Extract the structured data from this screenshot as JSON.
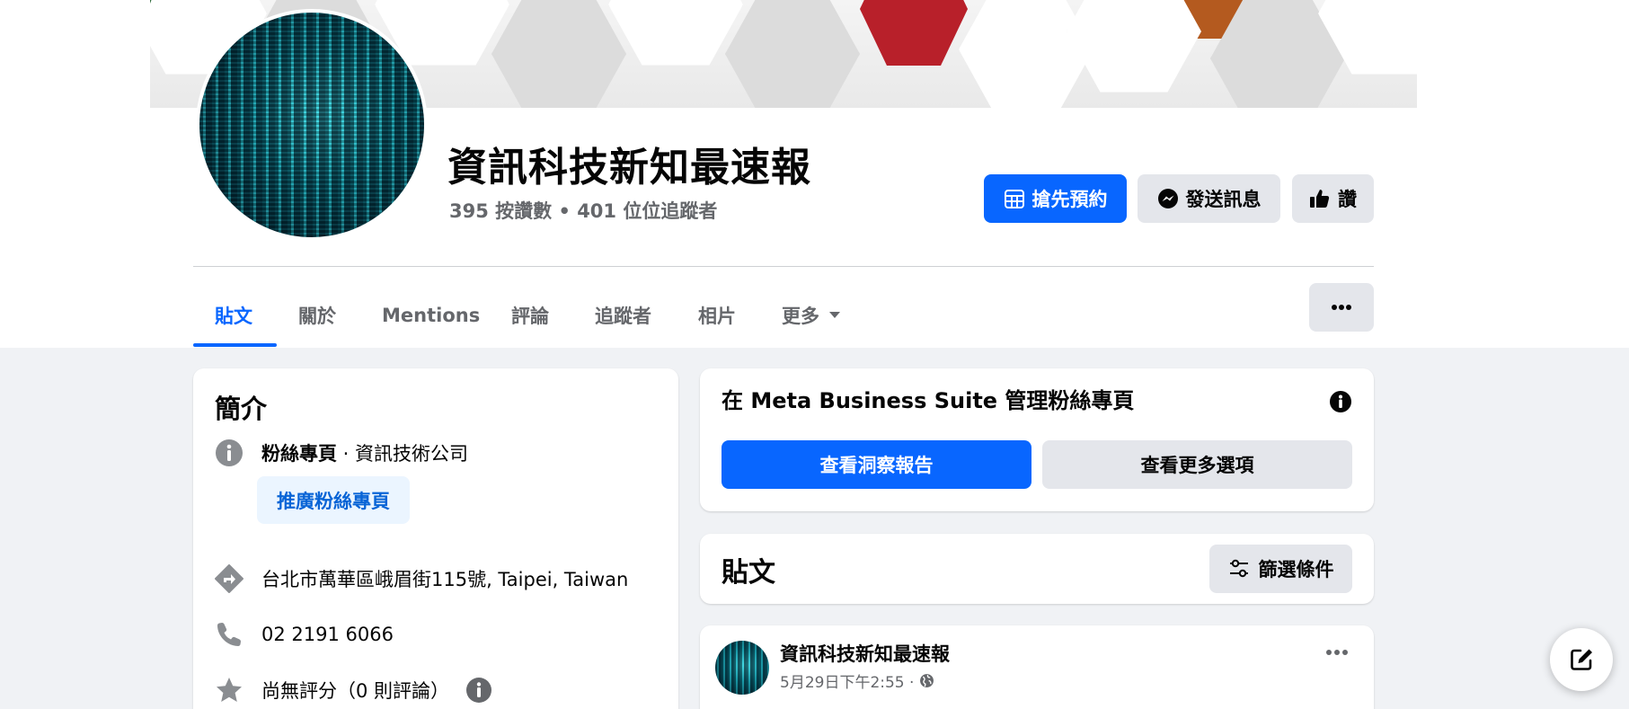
{
  "page": {
    "name": "資訊科技新知最速報",
    "stats": "395 按讚數 • 401 位位追蹤者"
  },
  "actions": {
    "book_label": "搶先預約",
    "message_label": "發送訊息",
    "like_label": "讚"
  },
  "tabs": [
    {
      "label": "貼文",
      "active": true
    },
    {
      "label": "關於"
    },
    {
      "label": "Mentions"
    },
    {
      "label": "評論"
    },
    {
      "label": "追蹤者"
    },
    {
      "label": "相片"
    },
    {
      "label": "更多"
    }
  ],
  "intro": {
    "title": "簡介",
    "category_bold": "粉絲專頁",
    "category_rest": " · 資訊技術公司",
    "promote_label": "推廣粉絲專頁",
    "address": "台北市萬華區峨眉街115號, Taipei, Taiwan",
    "phone": "02 2191 6066",
    "rating": "尚無評分（0 則評論）"
  },
  "meta_suite": {
    "title": "在 Meta Business Suite 管理粉絲專頁",
    "insights_label": "查看洞察報告",
    "more_options_label": "查看更多選項"
  },
  "posts": {
    "title": "貼文",
    "filter_label": "篩選條件"
  },
  "post": {
    "author": "資訊科技新知最速報",
    "time": "5月29日下午2:55 ·"
  },
  "colors": {
    "brand_blue": "#0866ff",
    "gray_button": "#e4e6eb",
    "background": "#f0f2f5"
  }
}
